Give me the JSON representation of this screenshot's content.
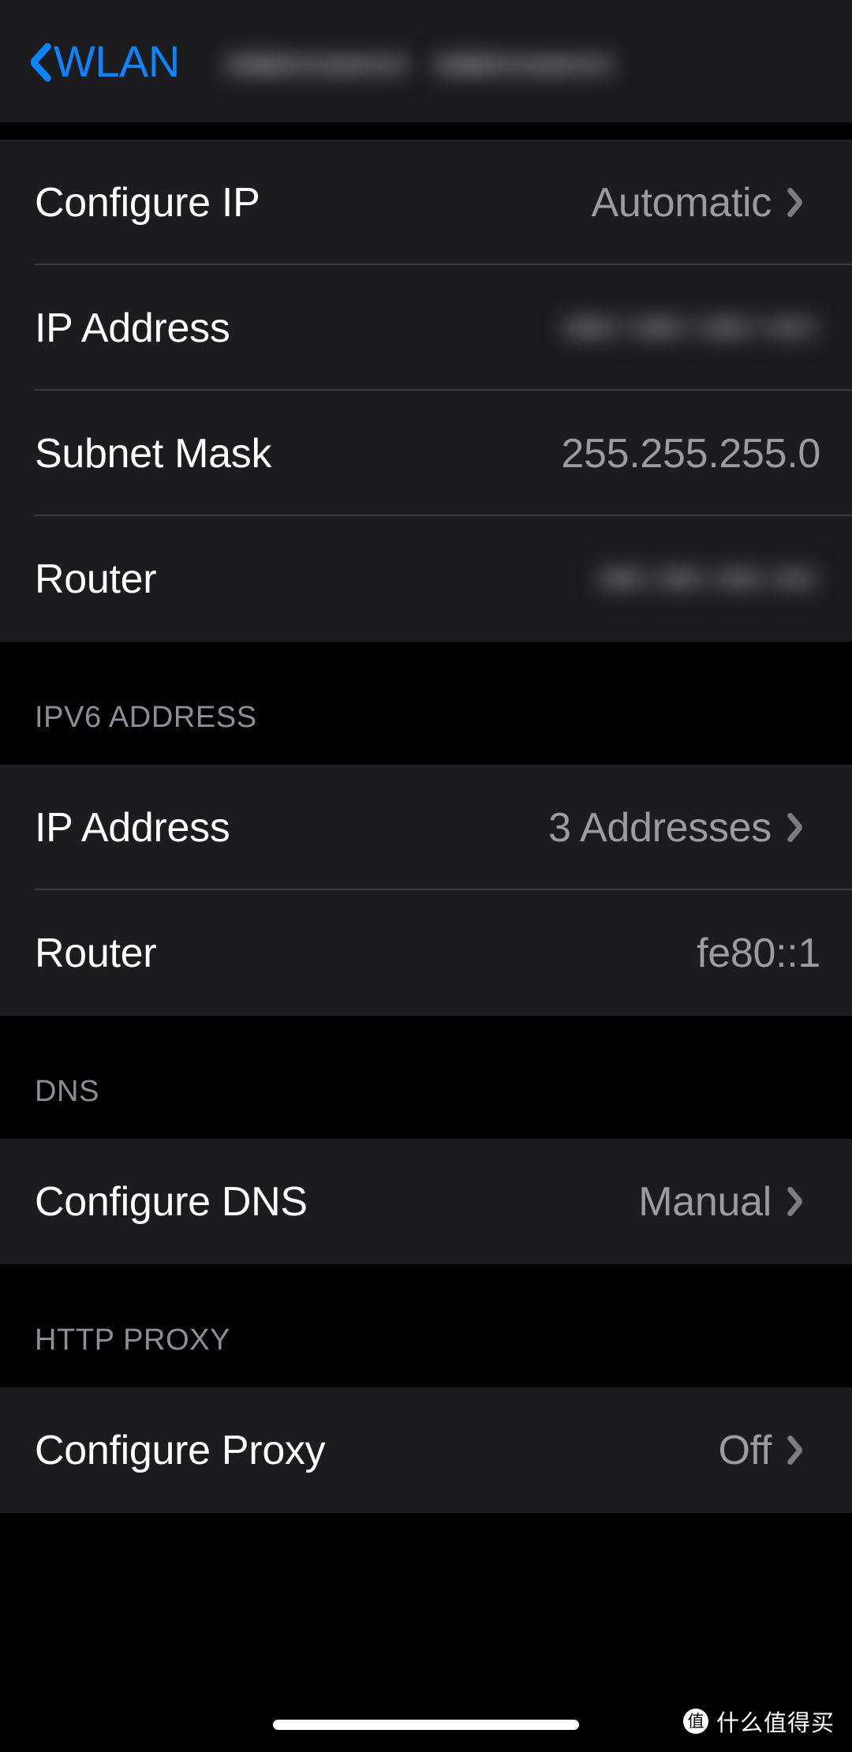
{
  "navbar": {
    "back_label": "WLAN",
    "back_icon": "chevron-left-icon",
    "title_redacted": true,
    "title_placeholder_words": 2
  },
  "sections": [
    {
      "key": "ipv4",
      "header": "",
      "rows": [
        {
          "label": "Configure IP",
          "value": "Automatic",
          "redacted": false,
          "chevron": true
        },
        {
          "label": "IP Address",
          "value": "",
          "redacted": true,
          "chevron": false,
          "blur_class": "ip4"
        },
        {
          "label": "Subnet Mask",
          "value": "255.255.255.0",
          "redacted": false,
          "chevron": false
        },
        {
          "label": "Router",
          "value": "",
          "redacted": true,
          "chevron": false,
          "blur_class": "rt4"
        }
      ]
    },
    {
      "key": "ipv6",
      "header": "IPV6 ADDRESS",
      "rows": [
        {
          "label": "IP Address",
          "value": "3 Addresses",
          "redacted": false,
          "chevron": true
        },
        {
          "label": "Router",
          "value": "fe80::1",
          "redacted": false,
          "chevron": false
        }
      ]
    },
    {
      "key": "dns",
      "header": "DNS",
      "rows": [
        {
          "label": "Configure DNS",
          "value": "Manual",
          "redacted": false,
          "chevron": true
        }
      ]
    },
    {
      "key": "proxy",
      "header": "HTTP PROXY",
      "rows": [
        {
          "label": "Configure Proxy",
          "value": "Off",
          "redacted": false,
          "chevron": true
        }
      ]
    }
  ],
  "watermark": {
    "logo_glyph": "值",
    "text": "什么值得买"
  },
  "colors": {
    "accent_blue": "#0a84ff",
    "row_background": "#1c1c1e",
    "page_background": "#000000",
    "label_text": "#ffffff",
    "value_text": "#9b9ba0",
    "section_header_text": "#8d8d93",
    "separator": "#3a3a3c",
    "home_indicator": "#ffffff"
  }
}
